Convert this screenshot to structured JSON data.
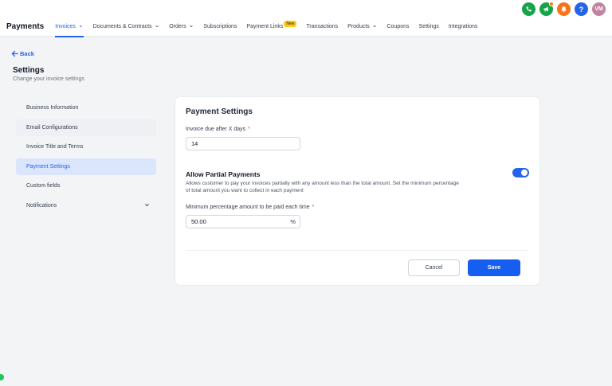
{
  "top_icons": [
    {
      "name": "phone-icon",
      "color": "#16a34a"
    },
    {
      "name": "megaphone-icon",
      "color": "#16a34a"
    },
    {
      "name": "bell-icon",
      "color": "#f97316"
    },
    {
      "name": "help-icon",
      "color": "#2563eb",
      "glyph": "?"
    },
    {
      "name": "avatar",
      "color": "#c084a0",
      "glyph": "VM"
    }
  ],
  "nav": {
    "brand": "Payments",
    "items": [
      {
        "label": "Invoices",
        "chevron": true,
        "active": true
      },
      {
        "label": "Documents & Contracts",
        "chevron": true
      },
      {
        "label": "Orders",
        "chevron": true
      },
      {
        "label": "Subscriptions"
      },
      {
        "label": "Payment Links",
        "badge": "New"
      },
      {
        "label": "Transactions"
      },
      {
        "label": "Products",
        "chevron": true
      },
      {
        "label": "Coupons"
      },
      {
        "label": "Settings"
      },
      {
        "label": "Integrations"
      }
    ]
  },
  "header": {
    "back_label": "Back",
    "title": "Settings",
    "subtitle": "Change your invoice settings"
  },
  "sidebar": {
    "items": [
      {
        "label": "Business Information"
      },
      {
        "label": "Email Configurations",
        "state": "hover"
      },
      {
        "label": "Invoice Title and Terms"
      },
      {
        "label": "Payment Settings",
        "state": "active"
      },
      {
        "label": "Custom fields"
      },
      {
        "label": "Notifications",
        "chevron": true
      }
    ]
  },
  "card": {
    "title": "Payment Settings",
    "due_label": "Invoice due after X days",
    "due_required": "*",
    "due_value": "14",
    "partial_title": "Allow Partial Payments",
    "partial_desc": "Allows customer to pay your invoices partially with any amount less than the total amount. Set the minimum percentage of total amount you want to collect in each payment",
    "partial_enabled": true,
    "min_label": "Minimum percentage amount to be paid each time",
    "min_required": "*",
    "min_value": "50.00",
    "min_suffix": "%",
    "cancel_label": "Cancel",
    "save_label": "Save"
  },
  "colors": {
    "accent": "#2563eb",
    "save": "#155eef",
    "active_bg": "#dbe6fd"
  }
}
